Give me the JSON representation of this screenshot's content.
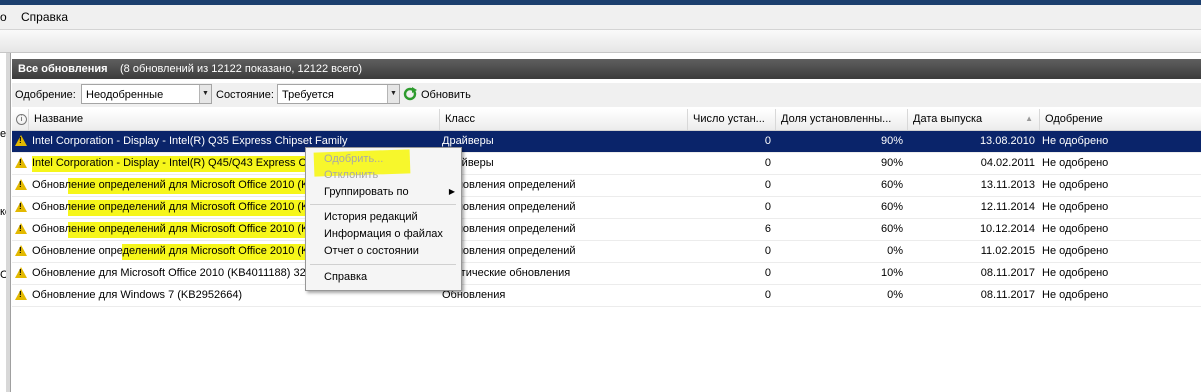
{
  "menu": {
    "partial": "о",
    "help": "Справка"
  },
  "left_fragments": [
    "е",
    "кс",
    "С"
  ],
  "panel": {
    "title": "Все обновления",
    "summary": "(8 обновлений из 12122 показано, 12122 всего)"
  },
  "filters": {
    "approval_label": "Одобрение:",
    "approval_value": "Неодобренные",
    "status_label": "Состояние:",
    "status_value": "Требуется",
    "refresh_label": "Обновить"
  },
  "columns": [
    "Название",
    "Класс",
    "Число устан...",
    "Доля установленны...",
    "Дата выпуска",
    "Одобрение"
  ],
  "rows": [
    {
      "name": "Intel Corporation - Display - Intel(R) Q35 Express Chipset Family",
      "class": "Драйверы",
      "count": "0",
      "share": "90%",
      "date": "13.08.2010",
      "approval": "Не одобрено"
    },
    {
      "name": "Intel Corporation - Display - Intel(R) Q45/Q43 Express Ch",
      "class": "Драйверы",
      "count": "0",
      "share": "90%",
      "date": "04.02.2011",
      "approval": "Не одобрено"
    },
    {
      "name": "Обновление определений для Microsoft Office 2010 (K",
      "class": "Обновления определений",
      "count": "0",
      "share": "60%",
      "date": "13.11.2013",
      "approval": "Не одобрено"
    },
    {
      "name": "Обновление определений для Microsoft Office 2010 (K",
      "class": "Обновления определений",
      "count": "0",
      "share": "60%",
      "date": "12.11.2014",
      "approval": "Не одобрено"
    },
    {
      "name": "Обновление определений для Microsoft Office 2010 (K",
      "class": "Обновления определений",
      "count": "6",
      "share": "60%",
      "date": "10.12.2014",
      "approval": "Не одобрено"
    },
    {
      "name": "Обновление определений для Microsoft Office 2010 (K",
      "class": "Обновления определений",
      "count": "0",
      "share": "0%",
      "date": "11.02.2015",
      "approval": "Не одобрено"
    },
    {
      "name": "Обновление для Microsoft Office 2010 (KB4011188) 32-",
      "class": "Критические обновления",
      "count": "0",
      "share": "10%",
      "date": "08.11.2017",
      "approval": "Не одобрено"
    },
    {
      "name": "Обновление для Windows 7 (KB2952664)",
      "class": "Обновления",
      "count": "0",
      "share": "0%",
      "date": "08.11.2017",
      "approval": "Не одобрено"
    }
  ],
  "context_menu": {
    "approve": "Одобрить...",
    "decline": "Отклонить",
    "group_by": "Группировать по",
    "revision_history": "История редакций",
    "file_info": "Информация о файлах",
    "status_report": "Отчет о состоянии",
    "help": "Справка"
  },
  "colors": {
    "selection": "#0a246a",
    "highlight": "#f6f61a",
    "header_bar": "#3c3c3c",
    "warning": "#e3b900"
  },
  "icons": {
    "row": "warning-icon",
    "refresh": "refresh-icon",
    "header_info": "info-icon"
  }
}
